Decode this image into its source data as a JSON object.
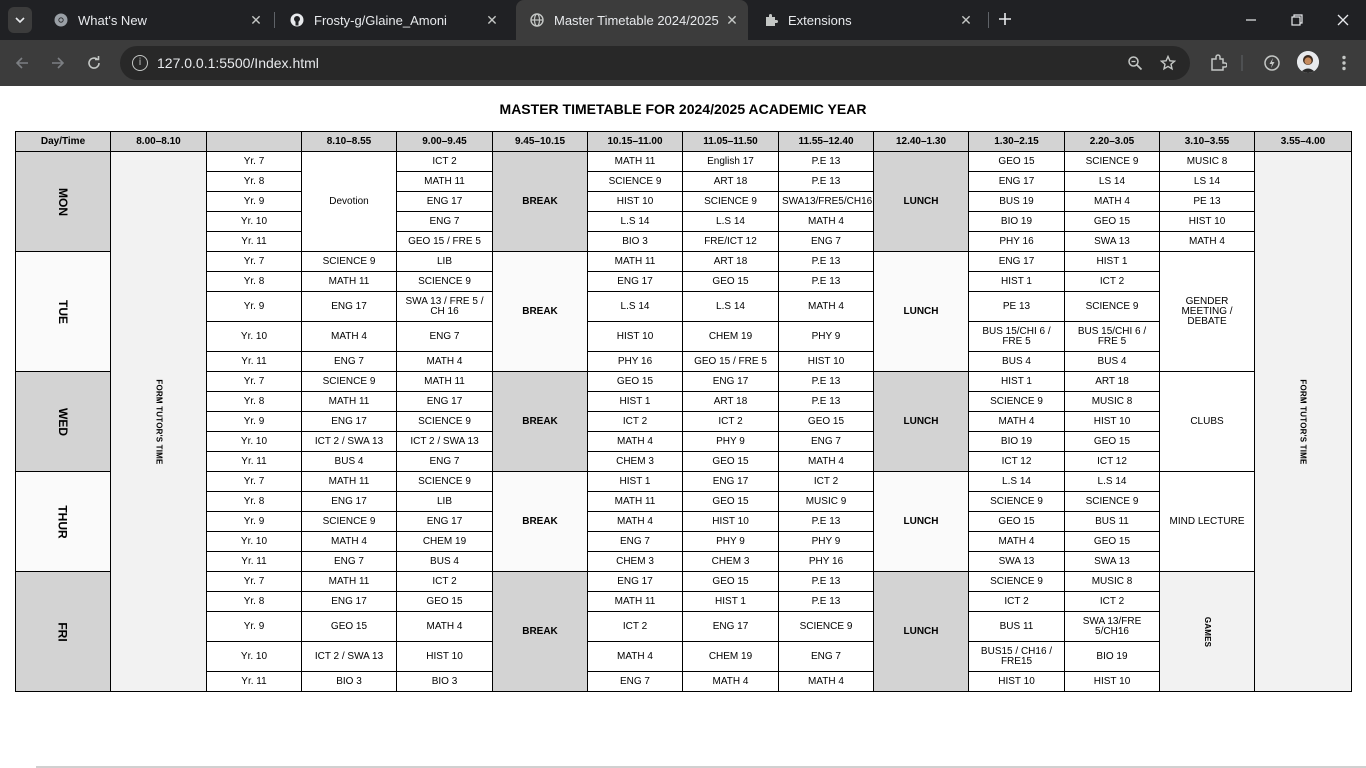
{
  "browser": {
    "tabs": [
      {
        "title": "What's New",
        "icon": "chrome-icon",
        "active": false
      },
      {
        "title": "Frosty-g/Glaine_Amoni",
        "icon": "github-icon",
        "active": false
      },
      {
        "title": "Master Timetable 2024/2025",
        "icon": "globe-icon",
        "active": true
      },
      {
        "title": "Extensions",
        "icon": "puzzle-icon",
        "active": false
      }
    ],
    "url": "127.0.0.1:5500/Index.html"
  },
  "page": {
    "title": "MASTER TIMETABLE FOR 2024/2025 ACADEMIC YEAR"
  },
  "timetable": {
    "headers": [
      "Day/Time",
      "8.00–8.10",
      "",
      "8.10–8.55",
      "9.00–9.45",
      "9.45–10.15",
      "10.15–11.00",
      "11.05–11.50",
      "11.55–12.40",
      "12.40–1.30",
      "1.30–2.15",
      "2.20–3.05",
      "3.10–3.55",
      "3.55–4.00"
    ],
    "form_tutor_left": "FORM TUTOR'S TIME",
    "form_tutor_right": "FORM TUTOR'S TIME",
    "days": [
      {
        "day": "MON",
        "p1_merged": "Devotion",
        "break": "BREAK",
        "lunch": "LUNCH",
        "rows": [
          {
            "year": "Yr. 7",
            "p2": "ICT 2",
            "p3": "MATH 11",
            "p4": "English 17",
            "p5": "P.E 13",
            "p6": "GEO 15",
            "p7": "SCIENCE 9",
            "p8": "MUSIC 8"
          },
          {
            "year": "Yr. 8",
            "p2": "MATH 11",
            "p3": "SCIENCE 9",
            "p4": "ART 18",
            "p5": "P.E 13",
            "p6": "ENG 17",
            "p7": "LS 14",
            "p8": "LS 14"
          },
          {
            "year": "Yr. 9",
            "p2": "ENG 17",
            "p3": "HIST 10",
            "p4": "SCIENCE 9",
            "p5": "SWA13/FRE5/CH16",
            "p6": "BUS 19",
            "p7": "MATH 4",
            "p8": "PE 13"
          },
          {
            "year": "Yr. 10",
            "p2": "ENG 7",
            "p3": "L.S 14",
            "p4": "L.S 14",
            "p5": "MATH 4",
            "p6": "BIO 19",
            "p7": "GEO 15",
            "p8": "HIST 10"
          },
          {
            "year": "Yr. 11",
            "p2": "GEO 15 / FRE 5",
            "p3": "BIO 3",
            "p4": "FRE/ICT 12",
            "p5": "ENG 7",
            "p6": "PHY 16",
            "p7": "SWA 13",
            "p8": "MATH 4"
          }
        ]
      },
      {
        "day": "TUE",
        "break": "BREAK",
        "lunch": "LUNCH",
        "p8_merged": "GENDER MEETING / DEBATE",
        "rows": [
          {
            "year": "Yr. 7",
            "p1": "SCIENCE 9",
            "p2": "LIB",
            "p3": "MATH 11",
            "p4": "ART 18",
            "p5": "P.E 13",
            "p6": "ENG 17",
            "p7": "HIST 1"
          },
          {
            "year": "Yr. 8",
            "p1": "MATH 11",
            "p2": "SCIENCE 9",
            "p3": "ENG 17",
            "p4": "GEO 15",
            "p5": "P.E 13",
            "p6": "HIST 1",
            "p7": "ICT 2"
          },
          {
            "year": "Yr. 9",
            "p1": "ENG 17",
            "p2": "SWA 13 / FRE 5 / CH 16",
            "p3": "L.S 14",
            "p4": "L.S 14",
            "p5": "MATH 4",
            "p6": "PE 13",
            "p7": "SCIENCE 9"
          },
          {
            "year": "Yr. 10",
            "p1": "MATH 4",
            "p2": "ENG 7",
            "p3": "HIST 10",
            "p4": "CHEM 19",
            "p5": "PHY 9",
            "p6": "BUS 15/CHI 6 / FRE 5",
            "p7": "BUS 15/CHI 6 / FRE 5"
          },
          {
            "year": "Yr. 11",
            "p1": "ENG 7",
            "p2": "MATH 4",
            "p3": "PHY 16",
            "p4": "GEO 15 / FRE 5",
            "p5": "HIST 10",
            "p6": "BUS 4",
            "p7": "BUS 4"
          }
        ]
      },
      {
        "day": "WED",
        "break": "BREAK",
        "lunch": "LUNCH",
        "p8_merged": "CLUBS",
        "rows": [
          {
            "year": "Yr. 7",
            "p1": "SCIENCE 9",
            "p2": "MATH 11",
            "p3": "GEO 15",
            "p4": "ENG 17",
            "p5": "P.E 13",
            "p6": "HIST 1",
            "p7": "ART 18"
          },
          {
            "year": "Yr. 8",
            "p1": "MATH 11",
            "p2": "ENG 17",
            "p3": "HIST 1",
            "p4": "ART 18",
            "p5": "P.E 13",
            "p6": "SCIENCE 9",
            "p7": "MUSIC 8"
          },
          {
            "year": "Yr. 9",
            "p1": "ENG 17",
            "p2": "SCIENCE 9",
            "p3": "ICT 2",
            "p4": "ICT 2",
            "p5": "GEO 15",
            "p6": "MATH 4",
            "p7": "HIST 10"
          },
          {
            "year": "Yr. 10",
            "p1": "ICT 2 / SWA 13",
            "p2": "ICT 2 / SWA 13",
            "p3": "MATH 4",
            "p4": "PHY 9",
            "p5": "ENG 7",
            "p6": "BIO 19",
            "p7": "GEO 15"
          },
          {
            "year": "Yr. 11",
            "p1": "BUS 4",
            "p2": "ENG 7",
            "p3": "CHEM 3",
            "p4": "GEO 15",
            "p5": "MATH 4",
            "p6": "ICT 12",
            "p7": "ICT 12"
          }
        ]
      },
      {
        "day": "THUR",
        "break": "BREAK",
        "lunch": "LUNCH",
        "p8_merged": "MIND LECTURE",
        "rows": [
          {
            "year": "Yr. 7",
            "p1": "MATH 11",
            "p2": "SCIENCE 9",
            "p3": "HIST 1",
            "p4": "ENG 17",
            "p5": "ICT 2",
            "p6": "L.S 14",
            "p7": "L.S 14"
          },
          {
            "year": "Yr. 8",
            "p1": "ENG 17",
            "p2": "LIB",
            "p3": "MATH 11",
            "p4": "GEO 15",
            "p5": "MUSIC 9",
            "p6": "SCIENCE 9",
            "p7": "SCIENCE 9"
          },
          {
            "year": "Yr. 9",
            "p1": "SCIENCE 9",
            "p2": "ENG 17",
            "p3": "MATH 4",
            "p4": "HIST 10",
            "p5": "P.E 13",
            "p6": "GEO 15",
            "p7": "BUS 11"
          },
          {
            "year": "Yr. 10",
            "p1": "MATH 4",
            "p2": "CHEM 19",
            "p3": "ENG 7",
            "p4": "PHY 9",
            "p5": "PHY 9",
            "p6": "MATH 4",
            "p7": "GEO 15"
          },
          {
            "year": "Yr. 11",
            "p1": "ENG 7",
            "p2": "BUS 4",
            "p3": "CHEM 3",
            "p4": "CHEM 3",
            "p5": "PHY 16",
            "p6": "SWA 13",
            "p7": "SWA 13"
          }
        ]
      },
      {
        "day": "FRI",
        "break": "BREAK",
        "lunch": "LUNCH",
        "p8_merged": "GAMES",
        "rows": [
          {
            "year": "Yr. 7",
            "p1": "MATH 11",
            "p2": "ICT 2",
            "p3": "ENG 17",
            "p4": "GEO 15",
            "p5": "P.E 13",
            "p6": "SCIENCE 9",
            "p7": "MUSIC 8"
          },
          {
            "year": "Yr. 8",
            "p1": "ENG 17",
            "p2": "GEO 15",
            "p3": "MATH 11",
            "p4": "HIST 1",
            "p5": "P.E 13",
            "p6": "ICT 2",
            "p7": "ICT 2"
          },
          {
            "year": "Yr. 9",
            "p1": "GEO 15",
            "p2": "MATH 4",
            "p3": "ICT 2",
            "p4": "ENG 17",
            "p5": "SCIENCE 9",
            "p6": "BUS 11",
            "p7": "SWA 13/FRE 5/CH16"
          },
          {
            "year": "Yr. 10",
            "p1": "ICT 2 / SWA 13",
            "p2": "HIST 10",
            "p3": "MATH 4",
            "p4": "CHEM 19",
            "p5": "ENG 7",
            "p6": "BUS15 / CH16 / FRE15",
            "p7": "BIO 19"
          },
          {
            "year": "Yr. 11",
            "p1": "BIO 3",
            "p2": "BIO 3",
            "p3": "ENG 7",
            "p4": "MATH 4",
            "p5": "MATH 4",
            "p6": "HIST 10",
            "p7": "HIST 10"
          }
        ]
      }
    ]
  }
}
